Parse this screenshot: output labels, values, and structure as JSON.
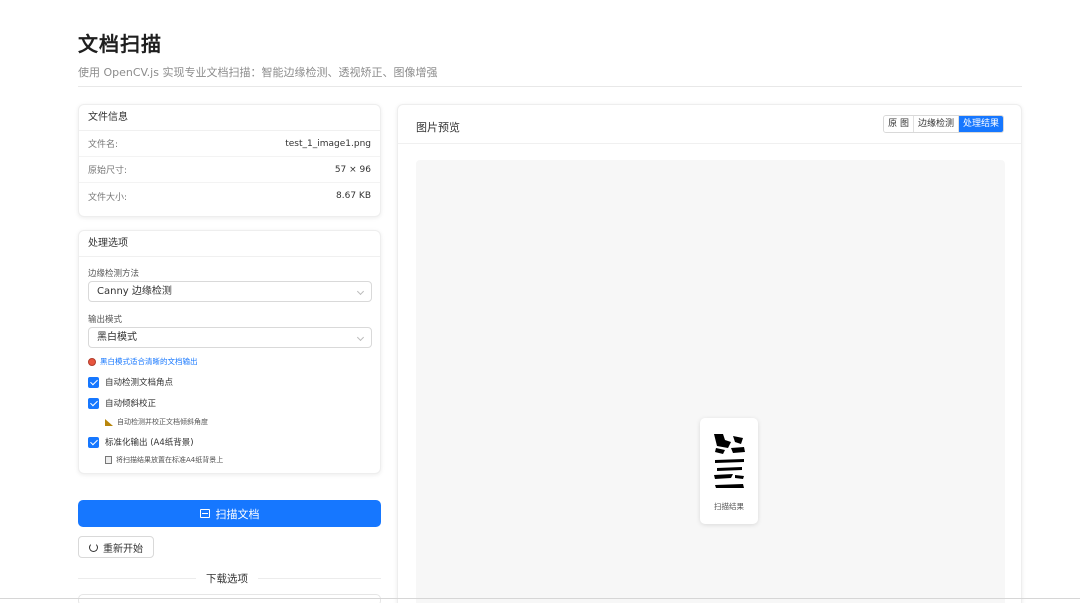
{
  "header": {
    "title": "文档扫描",
    "subtitle": "使用 OpenCV.js 实现专业文档扫描：智能边缘检测、透视矫正、图像增强"
  },
  "file_info": {
    "title": "文件信息",
    "rows": [
      {
        "label": "文件名:",
        "value": "test_1_image1.png"
      },
      {
        "label": "原始尺寸:",
        "value": "57 × 96"
      },
      {
        "label": "文件大小:",
        "value": "8.67 KB"
      }
    ]
  },
  "options": {
    "title": "处理选项",
    "edge_method": {
      "label": "边缘检测方法",
      "value": "Canny 边缘检测"
    },
    "output_mode": {
      "label": "输出模式",
      "value": "黑白模式"
    },
    "mode_hint": "黑白模式适合清晰的文档输出",
    "auto_corner": {
      "label": "自动检测文档角点",
      "checked": true
    },
    "auto_deskew": {
      "label": "自动倾斜校正",
      "checked": true,
      "hint": "自动检测并校正文档倾斜角度"
    },
    "standardize": {
      "label": "标准化输出 (A4纸背景)",
      "checked": true,
      "hint": "将扫描结果放置在标准A4纸背景上"
    }
  },
  "actions": {
    "scan_label": "扫描文档",
    "restart_label": "重新开始",
    "download_title": "下载选项"
  },
  "preview": {
    "title": "图片预览",
    "tabs": [
      {
        "label": "原 图",
        "active": false
      },
      {
        "label": "边缘检测",
        "active": false
      },
      {
        "label": "处理结果",
        "active": true
      }
    ],
    "thumb_caption": "扫描结果"
  },
  "colors": {
    "accent": "#1677ff",
    "hint_dot": "#e8553e"
  },
  "icons": {
    "scan": "scan-icon",
    "restart": "reload-icon",
    "mode_hint": "red-circle-icon",
    "deskew_hint": "ruler-icon",
    "standardize_hint": "note-icon"
  }
}
